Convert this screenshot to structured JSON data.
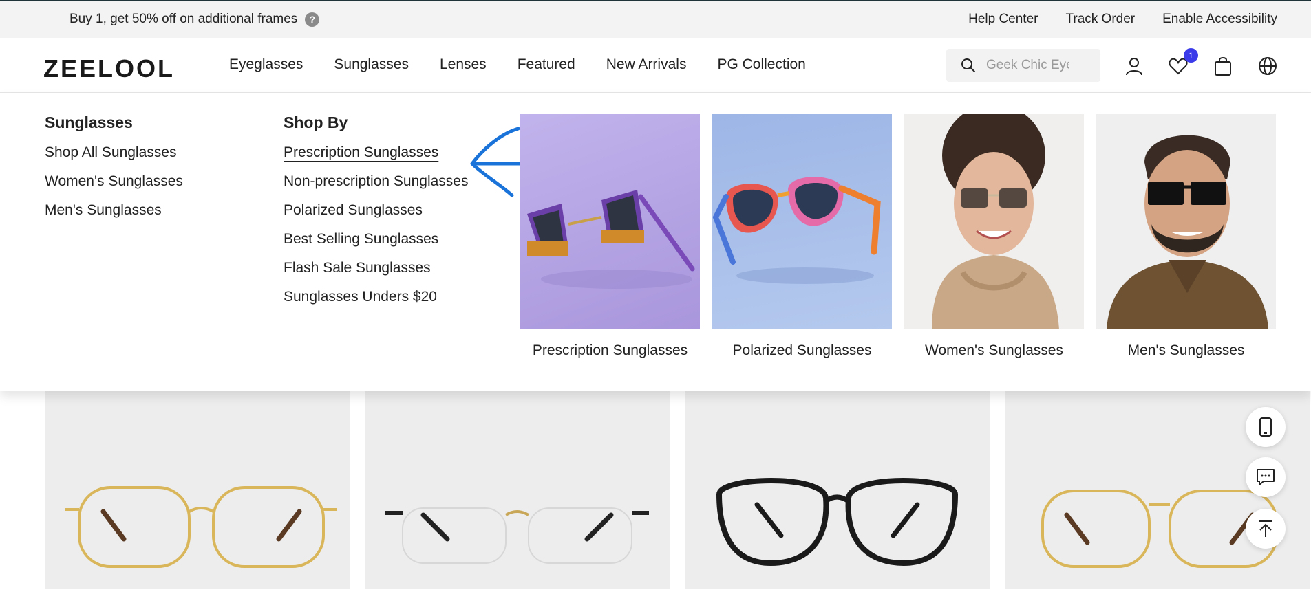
{
  "promo": {
    "text": "Buy 1, get 50% off on additional frames"
  },
  "toplinks": [
    "Help Center",
    "Track Order",
    "Enable Accessibility"
  ],
  "logo": "ZEELOOL",
  "nav": [
    "Eyeglasses",
    "Sunglasses",
    "Lenses",
    "Featured",
    "New Arrivals",
    "PG Collection"
  ],
  "search": {
    "placeholder": "Geek Chic Eyeglasses"
  },
  "wishlist": {
    "count": "1"
  },
  "menu": {
    "col1": {
      "title": "Sunglasses",
      "items": [
        "Shop All Sunglasses",
        "Women's Sunglasses",
        "Men's Sunglasses"
      ]
    },
    "col2": {
      "title": "Shop By",
      "items": [
        "Prescription Sunglasses",
        "Non-prescription Sunglasses",
        "Polarized Sunglasses",
        "Best Selling Sunglasses",
        "Flash Sale Sunglasses",
        "Sunglasses Unders $20"
      ]
    },
    "cards": [
      "Prescription Sunglasses",
      "Polarized Sunglasses",
      "Women's Sunglasses",
      "Men's Sunglasses"
    ]
  },
  "colors": {
    "accent": "#3b3bea",
    "annotation": "#1a73d9",
    "card1_bg": "#b7a9e3",
    "card2_bg": "#a3bde8"
  },
  "icons": [
    "help-icon",
    "search-icon",
    "user-icon",
    "heart-icon",
    "bag-icon",
    "globe-icon",
    "phone-icon",
    "chat-icon",
    "back-to-top-icon"
  ]
}
